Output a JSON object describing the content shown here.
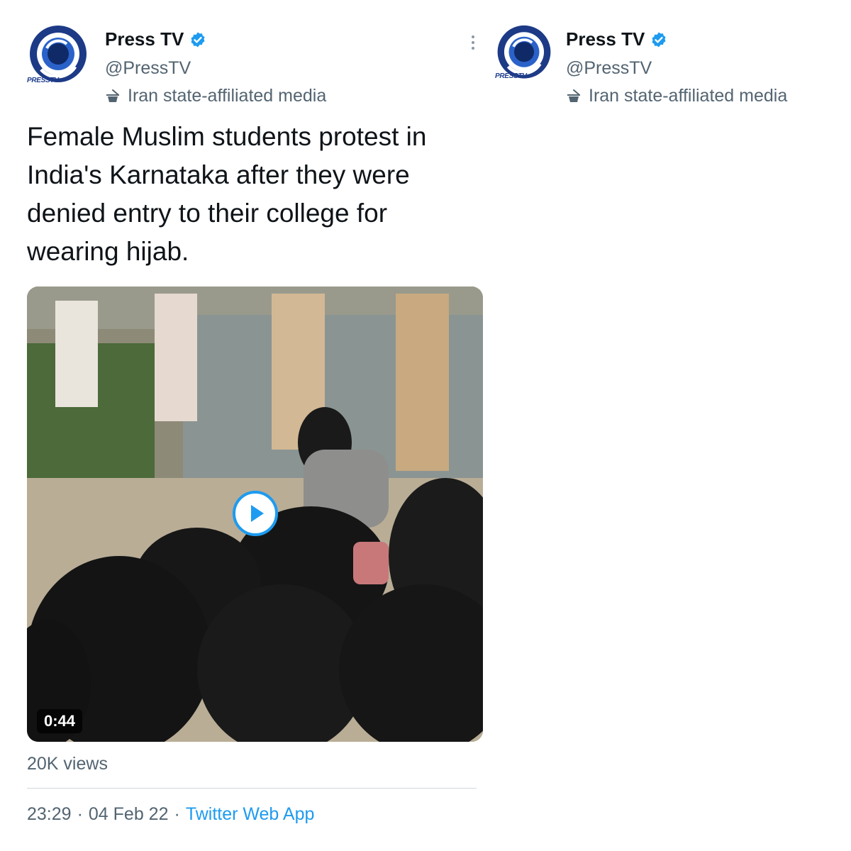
{
  "tweet": {
    "author_name": "Press TV",
    "handle": "@PressTV",
    "label": "Iran state-affiliated media",
    "avatar_brand": "PRESSTV",
    "text": "Female Muslim students protest in India's Karnataka after they were denied entry to their college for wearing hijab.",
    "video": {
      "duration": "0:44",
      "play_icon": "play-icon"
    },
    "views": "20K views",
    "time": "23:29",
    "date": "04 Feb 22",
    "separator": "·",
    "source_app": "Twitter Web App"
  },
  "header_copy": {
    "author_name": "Press TV",
    "handle": "@PressTV",
    "label": "Iran state-affiliated media",
    "avatar_brand": "PRESSTV"
  },
  "colors": {
    "text_primary": "#0f1419",
    "text_secondary": "#536471",
    "link": "#1d9bf0",
    "verified": "#1d9bf0"
  },
  "icons": [
    "verified-badge-icon",
    "state-media-icon",
    "more-options-icon",
    "play-icon"
  ]
}
